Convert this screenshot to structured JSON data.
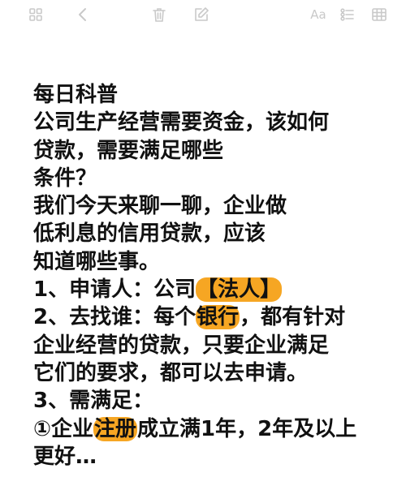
{
  "toolbar": {
    "format_label": "Aa"
  },
  "note": {
    "lines": [
      [
        {
          "t": "每日科普"
        }
      ],
      [
        {
          "t": "公司生产经营需要资金，该如何"
        }
      ],
      [
        {
          "t": "贷款，需要满足哪些"
        }
      ],
      [
        {
          "t": "条件？"
        }
      ],
      [
        {
          "t": "我们今天来聊一聊，企业做"
        }
      ],
      [
        {
          "t": "低利息的信用贷款，应该"
        }
      ],
      [
        {
          "t": "知道哪些事。"
        }
      ],
      [
        {
          "t": "1、申请人：公司"
        },
        {
          "t": "【法人】",
          "hl": true
        }
      ],
      [
        {
          "t": "2、去找谁：每个"
        },
        {
          "t": "银行",
          "hl": true
        },
        {
          "t": "，都有针对"
        }
      ],
      [
        {
          "t": "企业经营的贷款，只要企业满足"
        }
      ],
      [
        {
          "t": "它们的要求，都可以去申请。"
        }
      ],
      [
        {
          "t": "3、需满足："
        }
      ],
      [
        {
          "t": "①企业"
        },
        {
          "t": "注册",
          "hl": true
        },
        {
          "t": "成立满1年，2年及以上"
        }
      ],
      [
        {
          "t": "更好…"
        }
      ]
    ]
  },
  "colors": {
    "highlight": "#f6a623",
    "toolbar_icon": "#c9c9c9",
    "text": "#111111"
  }
}
